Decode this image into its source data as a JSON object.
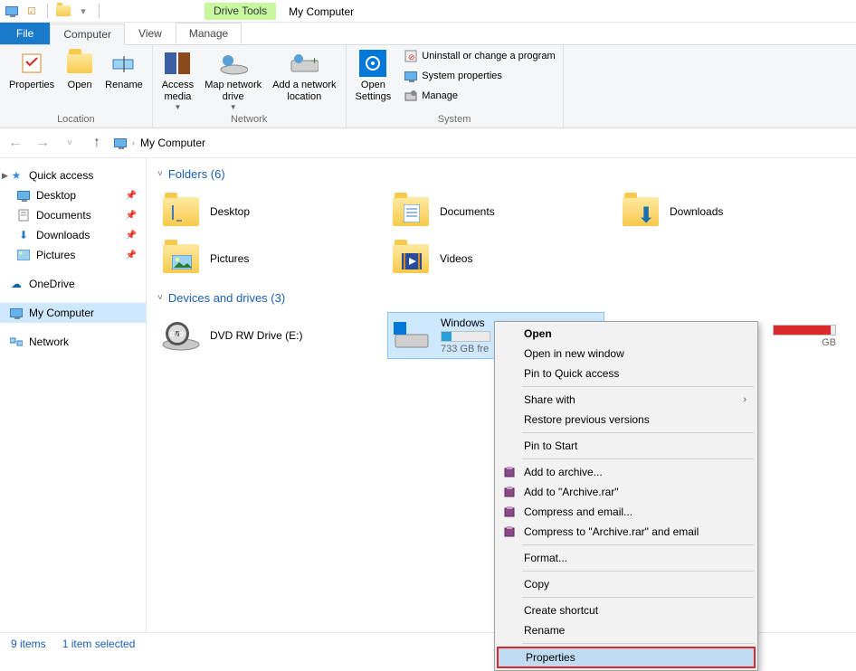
{
  "title_bar": {
    "context_tool_label": "Drive Tools",
    "window_title": "My Computer"
  },
  "tabs": {
    "file": "File",
    "computer": "Computer",
    "view": "View",
    "manage": "Manage"
  },
  "ribbon": {
    "location": {
      "properties": "Properties",
      "open": "Open",
      "rename": "Rename",
      "group_label": "Location"
    },
    "network": {
      "access_media": "Access\nmedia",
      "map_drive": "Map network\ndrive",
      "add_location": "Add a network\nlocation",
      "group_label": "Network"
    },
    "system": {
      "open_settings": "Open\nSettings",
      "uninstall": "Uninstall or change a program",
      "sys_props": "System properties",
      "manage": "Manage",
      "group_label": "System"
    }
  },
  "breadcrumb": {
    "location": "My Computer"
  },
  "sidebar": {
    "quick_access": "Quick access",
    "desktop": "Desktop",
    "documents": "Documents",
    "downloads": "Downloads",
    "pictures": "Pictures",
    "onedrive": "OneDrive",
    "my_computer": "My Computer",
    "network": "Network"
  },
  "content": {
    "folders_header": "Folders (6)",
    "folders": {
      "desktop": "Desktop",
      "documents": "Documents",
      "downloads": "Downloads",
      "pictures": "Pictures",
      "videos": "Videos"
    },
    "devices_header": "Devices and drives (3)",
    "drives": {
      "dvd": "DVD RW Drive (E:)",
      "windows_c": {
        "name": "Windows",
        "free": "733 GB fre"
      },
      "other": {
        "free_suffix": "GB"
      }
    }
  },
  "context_menu": {
    "open": "Open",
    "open_new": "Open in new window",
    "pin_qa": "Pin to Quick access",
    "share_with": "Share with",
    "restore": "Restore previous versions",
    "pin_start": "Pin to Start",
    "add_archive": "Add to archive...",
    "add_archive_rar": "Add to \"Archive.rar\"",
    "compress_email": "Compress and email...",
    "compress_rar_email": "Compress to \"Archive.rar\" and email",
    "format": "Format...",
    "copy": "Copy",
    "create_shortcut": "Create shortcut",
    "rename": "Rename",
    "properties": "Properties"
  },
  "status": {
    "items": "9 items",
    "selected": "1 item selected"
  }
}
